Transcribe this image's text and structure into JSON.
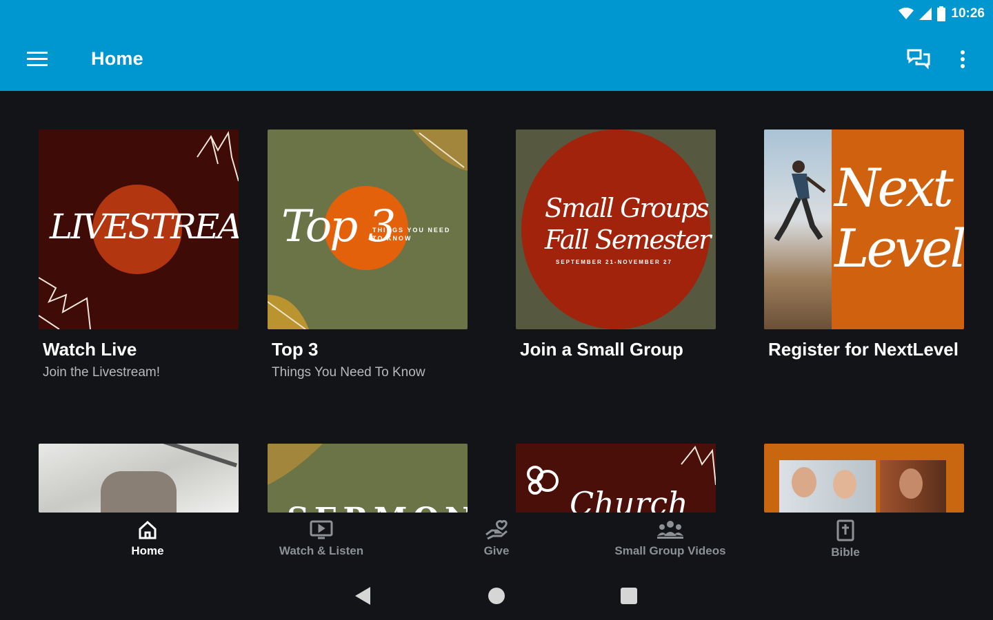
{
  "status_bar": {
    "time": "10:26"
  },
  "app_bar": {
    "title": "Home"
  },
  "cards": [
    {
      "thumb_text": "LIVESTREAM",
      "title": "Watch Live",
      "subtitle": "Join the Livestream!"
    },
    {
      "thumb_text": "Top 3",
      "thumb_small": "THINGS YOU NEED TO KNOW",
      "title": "Top 3",
      "subtitle": "Things You Need To Know"
    },
    {
      "thumb_text_1": "Small Groups",
      "thumb_text_2": "Fall Semester",
      "thumb_small": "SEPTEMBER 21-NOVEMBER 27",
      "title": "Join a Small Group",
      "subtitle": ""
    },
    {
      "thumb_text_1": "Next",
      "thumb_text_2": "Level",
      "title": "Register for NextLevel",
      "subtitle": ""
    }
  ],
  "row2": [
    {
      "thumb_text": ""
    },
    {
      "thumb_text": "SERMON"
    },
    {
      "thumb_text": "Church"
    },
    {
      "thumb_text": ""
    }
  ],
  "bottom_nav": [
    {
      "label": "Home",
      "icon": "home-icon",
      "active": true
    },
    {
      "label": "Watch & Listen",
      "icon": "tv-icon",
      "active": false
    },
    {
      "label": "Give",
      "icon": "give-hand-heart-icon",
      "active": false
    },
    {
      "label": "Small Group Videos",
      "icon": "group-icon",
      "active": false
    },
    {
      "label": "Bible",
      "icon": "bible-icon",
      "active": false
    }
  ],
  "colors": {
    "app_bar": "#0097d1",
    "background": "#121417",
    "accent_orange": "#d9620e"
  }
}
